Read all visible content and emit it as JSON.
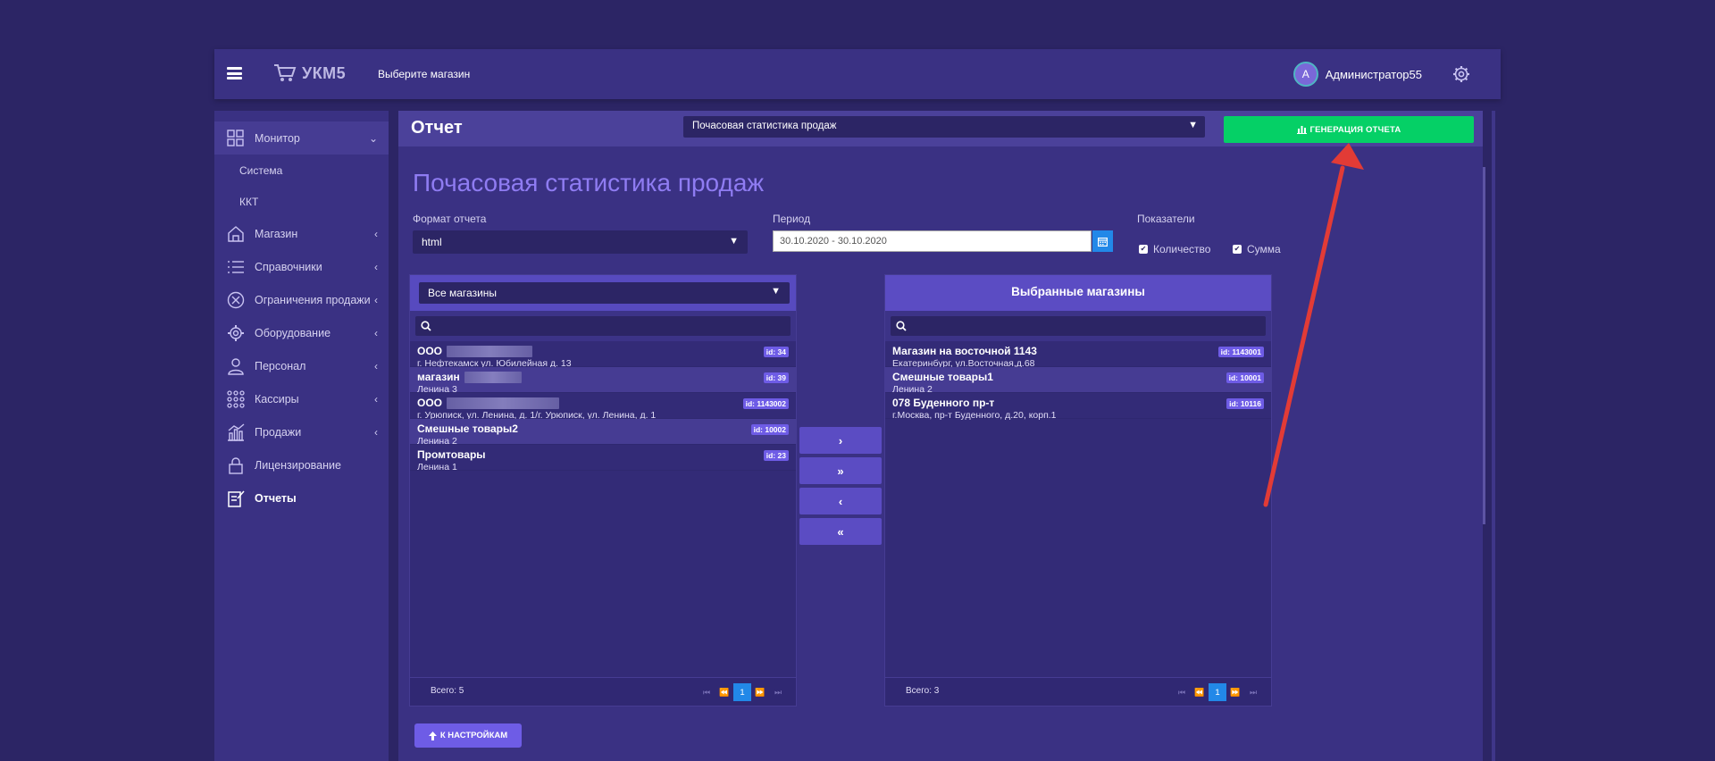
{
  "header": {
    "app_name": "УКМ5",
    "store_select": "Выберите магазин",
    "avatar_letter": "A",
    "user_name": "Администратор55"
  },
  "sidebar": {
    "monitor": "Монитор",
    "monitor_sub": [
      "Система",
      "ККТ"
    ],
    "items": [
      {
        "label": "Магазин",
        "icon": "store-icon"
      },
      {
        "label": "Справочники",
        "icon": "list-icon"
      },
      {
        "label": "Ограничения продажи",
        "icon": "restrict-icon"
      },
      {
        "label": "Оборудование",
        "icon": "gear-icon"
      },
      {
        "label": "Персонал",
        "icon": "user-icon"
      },
      {
        "label": "Кассиры",
        "icon": "cashiers-icon"
      },
      {
        "label": "Продажи",
        "icon": "sales-icon"
      },
      {
        "label": "Лицензирование",
        "icon": "lock-icon"
      },
      {
        "label": "Отчеты",
        "icon": "report-icon"
      }
    ]
  },
  "main": {
    "title": "Отчет",
    "report_type": "Почасовая статистика продаж",
    "generate_label": "ГЕНЕРАЦИЯ ОТЧЕТА",
    "heading": "Почасовая статистика продаж",
    "format_label": "Формат отчета",
    "format_value": "html",
    "period_label": "Период",
    "period_value": "30.10.2020 - 30.10.2020",
    "indicators_label": "Показатели",
    "indicator_qty": "Количество",
    "indicator_sum": "Сумма",
    "back_label": "К НАСТРОЙКАМ"
  },
  "left_panel": {
    "filter": "Все магазины",
    "total": "Всего: 5",
    "page": "1",
    "rows": [
      {
        "name": "ООО",
        "addr": "г. Нефтекамск ул. Юбилейная д. 13",
        "id": "id: 34"
      },
      {
        "name": "магазин",
        "addr": "Ленина 3",
        "id": "id: 39"
      },
      {
        "name": "ООО",
        "addr": "г. Урюпиcк, ул. Ленина, д. 1/г. Урюпиcк, ул. Ленина, д. 1",
        "id": "id: 1143002"
      },
      {
        "name": "Смешные товары2",
        "addr": "Ленина 2",
        "id": "id: 10002"
      },
      {
        "name": "Промтовары",
        "addr": "Ленина 1",
        "id": "id: 23"
      }
    ]
  },
  "right_panel": {
    "title": "Выбранные магазины",
    "total": "Всего: 3",
    "page": "1",
    "rows": [
      {
        "name": "Магазин на восточной 1143",
        "addr": "Екатеринбург, ул.Восточная,д.68",
        "id": "id: 1143001"
      },
      {
        "name": "Смешные товары1",
        "addr": "Ленина 2",
        "id": "id: 10001"
      },
      {
        "name": "078 Буденного пр-т",
        "addr": "г.Москва, пр-т Буденного, д.20, корп.1",
        "id": "id: 10116"
      }
    ]
  },
  "move_buttons": [
    "›",
    "»",
    "‹",
    "«"
  ],
  "colors": {
    "accent": "#6e5ce6",
    "success": "#05d066",
    "annotation_arrow": "#e23b36"
  }
}
